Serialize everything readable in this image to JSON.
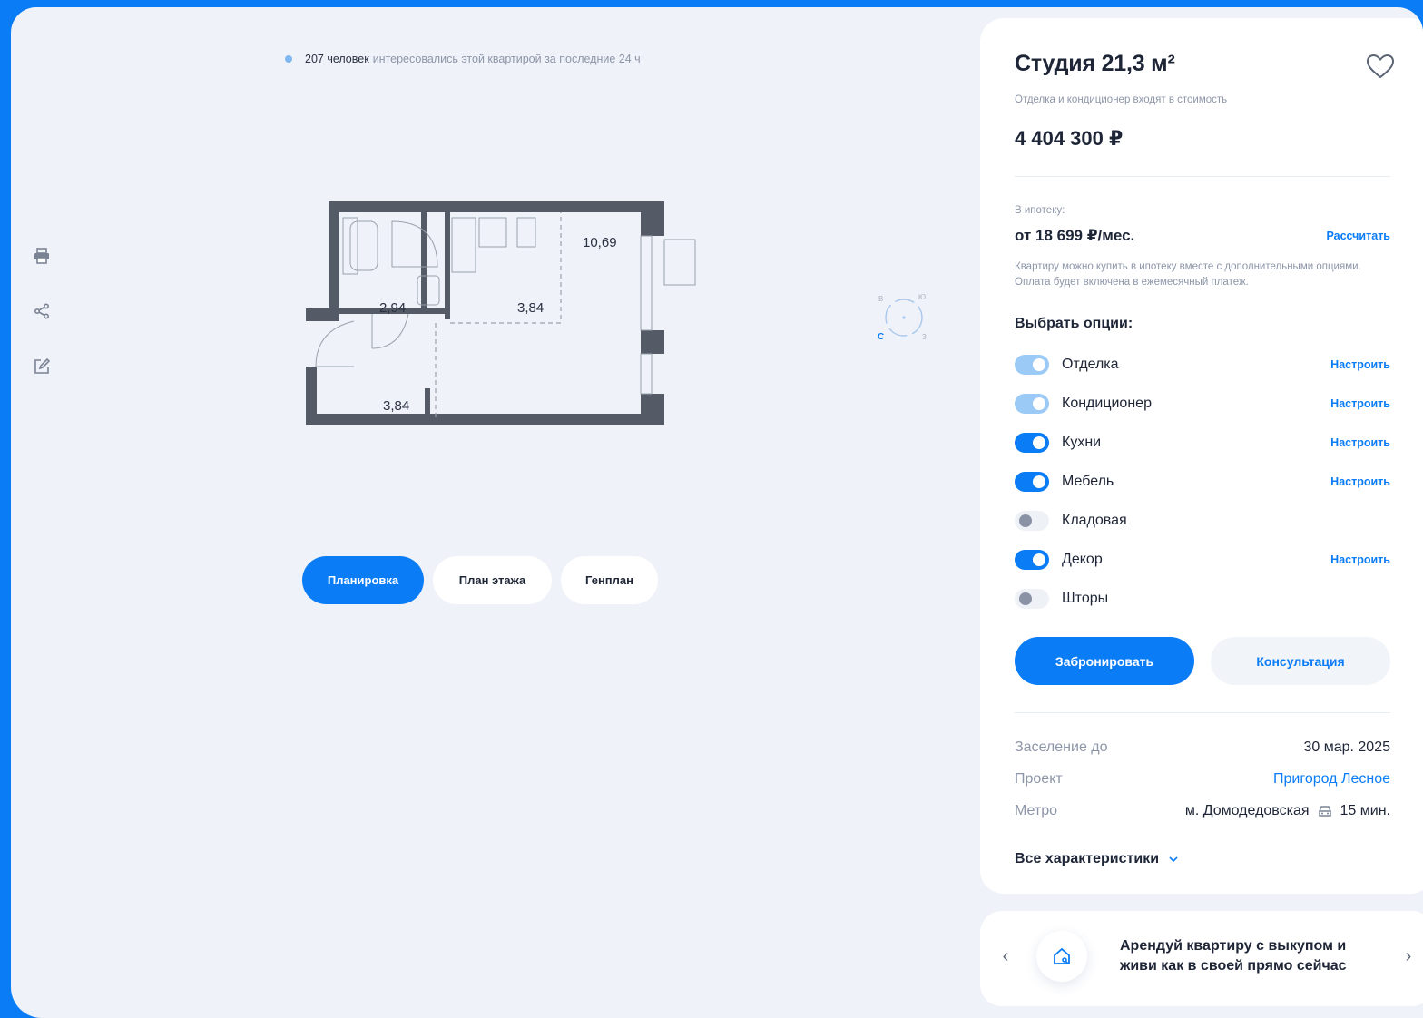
{
  "tools": [
    {
      "name": "print-icon"
    },
    {
      "name": "share-icon"
    },
    {
      "name": "edit-icon"
    }
  ],
  "interest": {
    "count": "207 человек",
    "text": "интересовались этой квартирой за последние 24 ч"
  },
  "plan": {
    "rooms": [
      "10,69",
      "2,94",
      "3,84",
      "3,84"
    ],
    "compass": [
      "Ю",
      "В",
      "С",
      "З"
    ]
  },
  "view_tabs": [
    {
      "label": "Планировка",
      "active": true
    },
    {
      "label": "План этажа",
      "active": false
    },
    {
      "label": "Генплан",
      "active": false
    }
  ],
  "card": {
    "title": "Студия 21,3 м²",
    "subtitle": "Отделка и кондиционер входят в стоимость",
    "price": "4 404 300 ₽",
    "mortgage_label": "В ипотеку:",
    "mortgage_value": "от 18 699 ₽/мес.",
    "calculate": "Рассчитать",
    "mortgage_note": "Квартиру можно купить в ипотеку вместе с дополнительными опциями. Оплата будет включена в ежемесячный платеж.",
    "options_title": "Выбрать опции:",
    "options": [
      {
        "label": "Отделка",
        "state": "soft",
        "configure": "Настроить"
      },
      {
        "label": "Кондиционер",
        "state": "soft",
        "configure": "Настроить"
      },
      {
        "label": "Кухни",
        "state": "on",
        "configure": "Настроить"
      },
      {
        "label": "Мебель",
        "state": "on",
        "configure": "Настроить"
      },
      {
        "label": "Кладовая",
        "state": "off",
        "configure": ""
      },
      {
        "label": "Декор",
        "state": "on",
        "configure": "Настроить"
      },
      {
        "label": "Шторы",
        "state": "off",
        "configure": ""
      }
    ],
    "book_button": "Забронировать",
    "consult_button": "Консультация",
    "info": {
      "move_in_label": "Заселение до",
      "move_in_value": "30 мар. 2025",
      "project_label": "Проект",
      "project_value": "Пригород Лесное",
      "metro_label": "Метро",
      "metro_value": "м. Домодедовская",
      "metro_time": "15 мин."
    },
    "all_chars": "Все характеристики"
  },
  "promo": {
    "text": "Арендуй квартиру с выкупом и живи как в своей прямо сейчас"
  },
  "colors": {
    "accent": "#0a7cf6",
    "background": "#eff2f8",
    "muted": "#8d96a8"
  }
}
